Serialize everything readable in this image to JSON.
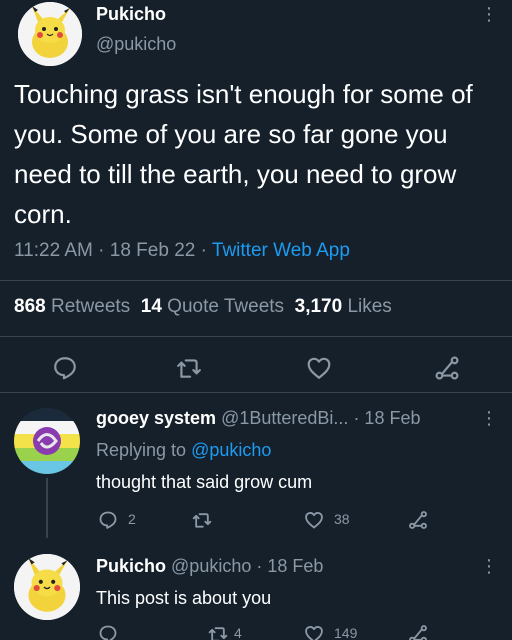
{
  "main_tweet": {
    "display_name": "Pukicho",
    "handle": "@pukicho",
    "text": "Touching grass isn't enough for some of you. Some of you are so far gone you need to till the earth, you need to grow corn.",
    "time": "11:22 AM",
    "date": "18 Feb 22",
    "source": "Twitter Web App",
    "separator": "·",
    "retweets_count": "868",
    "retweets_label": "Retweets",
    "quotes_count": "14",
    "quotes_label": "Quote Tweets",
    "likes_count": "3,170",
    "likes_label": "Likes",
    "more": "⋮"
  },
  "reply1": {
    "display_name": "gooey system",
    "handle": "@1ButteredBi...",
    "date": "· 18 Feb",
    "replying_prefix": "Replying to",
    "replying_to": "@pukicho",
    "text": "thought that said grow cum",
    "reply_count": "2",
    "like_count": "38",
    "more": "⋮"
  },
  "reply2": {
    "display_name": "Pukicho",
    "handle": "@pukicho",
    "date": "· 18 Feb",
    "text": "This post is about you",
    "retweet_count": "4",
    "like_count": "149",
    "more": "⋮"
  },
  "colors": {
    "background": "#15202b",
    "muted": "#8b98a5",
    "link": "#1d9bf0",
    "divider": "#38444d"
  },
  "icons": [
    "reply-icon",
    "retweet-icon",
    "like-icon",
    "share-icon",
    "more-icon"
  ]
}
